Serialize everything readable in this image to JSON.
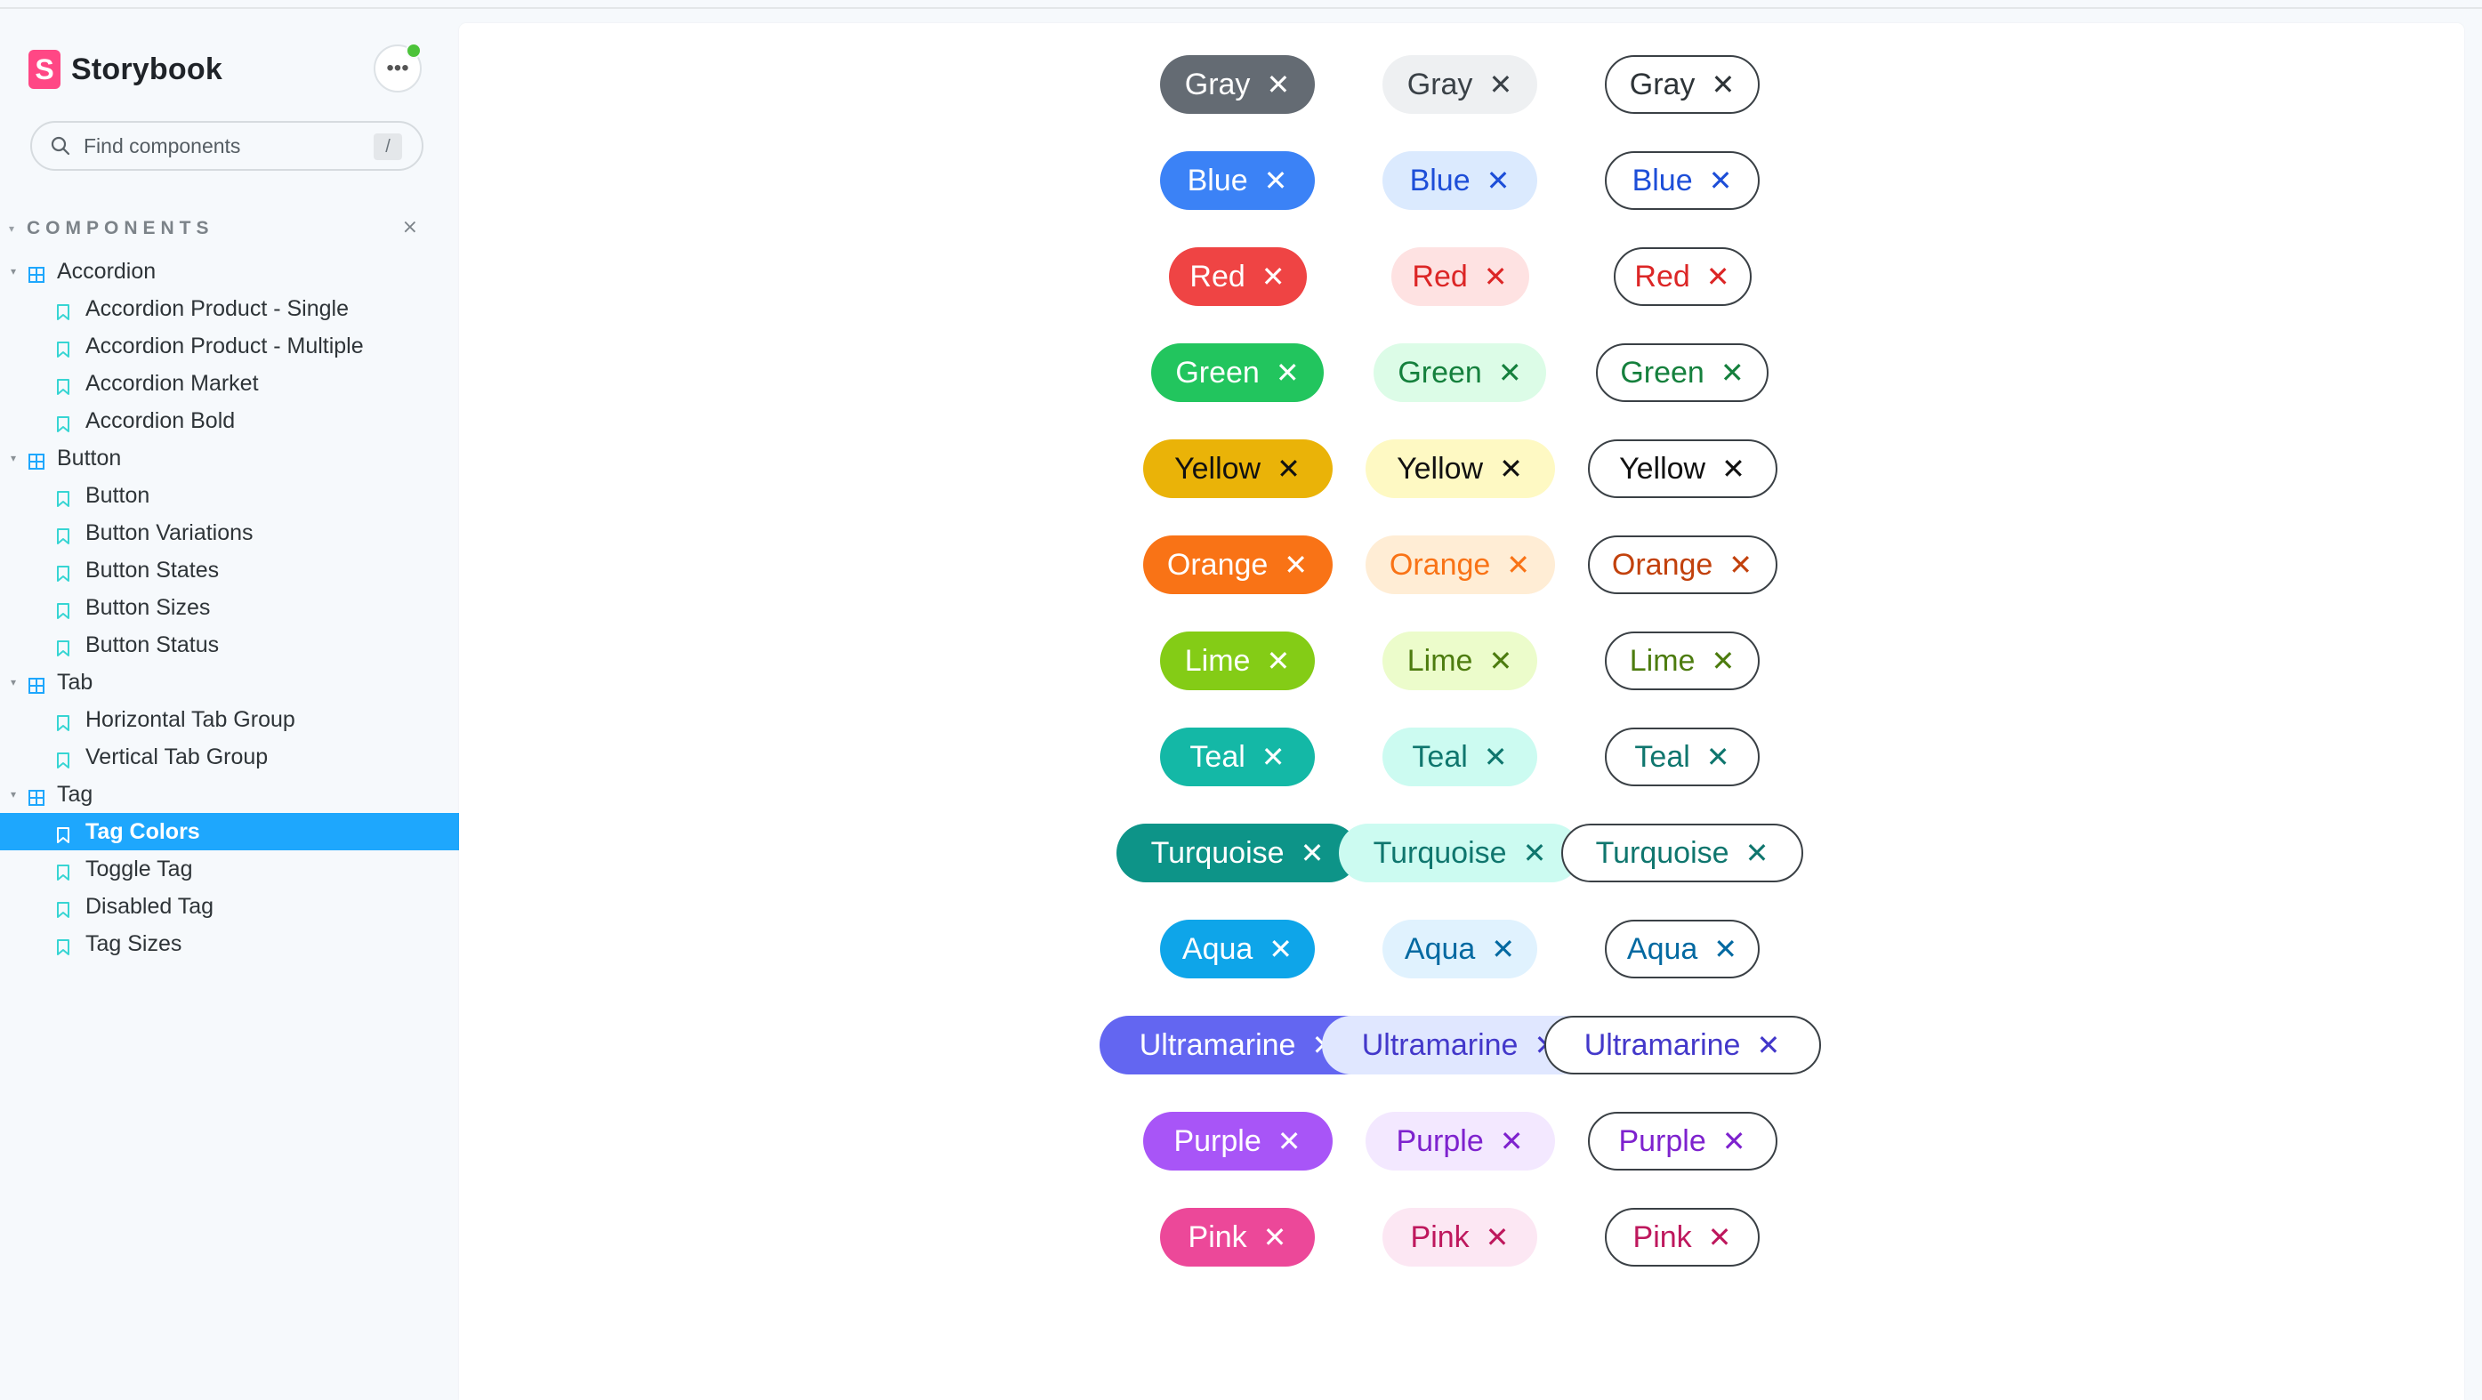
{
  "app": {
    "name": "Storybook",
    "logo_letter": "S"
  },
  "header": {
    "menu_icon": "ellipsis-icon",
    "status_color": "#4cc33a"
  },
  "search": {
    "placeholder": "Find components",
    "shortcut": "/"
  },
  "sidebar": {
    "section_title": "COMPONENTS",
    "groups": [
      {
        "label": "Accordion",
        "stories": [
          "Accordion Product - Single",
          "Accordion Product - Multiple",
          "Accordion Market",
          "Accordion Bold"
        ]
      },
      {
        "label": "Button",
        "stories": [
          "Button",
          "Button Variations",
          "Button States",
          "Button Sizes",
          "Button Status"
        ]
      },
      {
        "label": "Tab",
        "stories": [
          "Horizontal Tab Group",
          "Vertical Tab Group"
        ]
      },
      {
        "label": "Tag",
        "stories": [
          "Tag Colors",
          "Toggle Tag",
          "Disabled Tag",
          "Tag Sizes"
        ]
      }
    ],
    "selected_story": "Tag Colors",
    "accent": "#1ea7fd"
  },
  "tags": {
    "close_glyph": "✕",
    "rows": [
      {
        "label": "Gray",
        "solid": "#646b73",
        "solid_text": "#ffffff",
        "light_bg": "#eef0f2",
        "light_text": "#3a4147",
        "outline_text": "#2e3438"
      },
      {
        "label": "Blue",
        "solid": "#3b82f6",
        "solid_text": "#ffffff",
        "light_bg": "#dbeafe",
        "light_text": "#1d4ed8",
        "outline_text": "#1d4ed8"
      },
      {
        "label": "Red",
        "solid": "#ef4444",
        "solid_text": "#ffffff",
        "light_bg": "#fee2e2",
        "light_text": "#dc2626",
        "outline_text": "#dc2626"
      },
      {
        "label": "Green",
        "solid": "#22c55e",
        "solid_text": "#ffffff",
        "light_bg": "#dcfce7",
        "light_text": "#15803d",
        "outline_text": "#15803d"
      },
      {
        "label": "Yellow",
        "solid": "#eab308",
        "solid_text": "#111111",
        "light_bg": "#fef9c3",
        "light_text": "#111111",
        "outline_text": "#111111"
      },
      {
        "label": "Orange",
        "solid": "#f97316",
        "solid_text": "#ffffff",
        "light_bg": "#ffedd5",
        "light_text": "#f97316",
        "outline_text": "#c2410c"
      },
      {
        "label": "Lime",
        "solid": "#84cc16",
        "solid_text": "#ffffff",
        "light_bg": "#ecfccb",
        "light_text": "#4d7c0f",
        "outline_text": "#4d7c0f"
      },
      {
        "label": "Teal",
        "solid": "#14b8a6",
        "solid_text": "#ffffff",
        "light_bg": "#ccfbf1",
        "light_text": "#0f766e",
        "outline_text": "#0f766e"
      },
      {
        "label": "Turquoise",
        "solid": "#0d9488",
        "solid_text": "#ffffff",
        "light_bg": "#ccfbf1",
        "light_text": "#0f766e",
        "outline_text": "#0f766e"
      },
      {
        "label": "Aqua",
        "solid": "#0ea5e9",
        "solid_text": "#ffffff",
        "light_bg": "#e0f2fe",
        "light_text": "#0369a1",
        "outline_text": "#0369a1"
      },
      {
        "label": "Ultramarine",
        "solid": "#6366f1",
        "solid_text": "#ffffff",
        "light_bg": "#e0e7ff",
        "light_text": "#4338ca",
        "outline_text": "#4338ca"
      },
      {
        "label": "Purple",
        "solid": "#a855f7",
        "solid_text": "#ffffff",
        "light_bg": "#f3e8ff",
        "light_text": "#7e22ce",
        "outline_text": "#7e22ce"
      },
      {
        "label": "Pink",
        "solid": "#ec4899",
        "solid_text": "#ffffff",
        "light_bg": "#fce7f3",
        "light_text": "#be185d",
        "outline_text": "#be185d"
      }
    ]
  }
}
